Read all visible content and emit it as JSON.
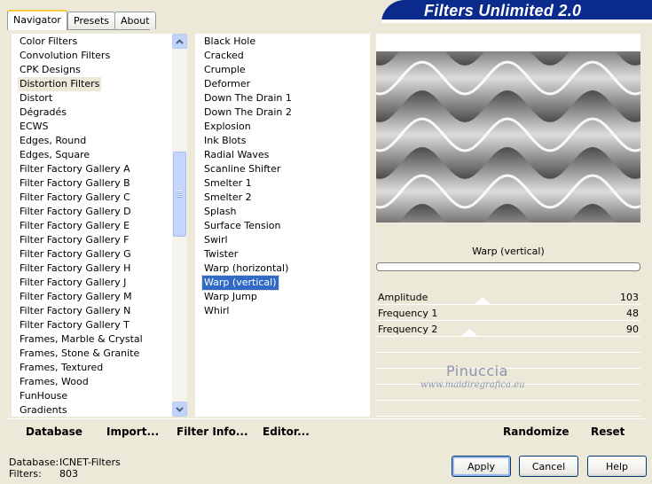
{
  "tabs": [
    {
      "label": "Navigator"
    },
    {
      "label": "Presets"
    },
    {
      "label": "About"
    }
  ],
  "banner_title": "Filters Unlimited 2.0",
  "categories": [
    "Color Filters",
    "Convolution Filters",
    "CPK Designs",
    "Distortion Filters",
    "Distort",
    "Dégradés",
    "ECWS",
    "Edges, Round",
    "Edges, Square",
    "Filter Factory Gallery A",
    "Filter Factory Gallery B",
    "Filter Factory Gallery C",
    "Filter Factory Gallery D",
    "Filter Factory Gallery E",
    "Filter Factory Gallery F",
    "Filter Factory Gallery G",
    "Filter Factory Gallery H",
    "Filter Factory Gallery J",
    "Filter Factory Gallery M",
    "Filter Factory Gallery N",
    "Filter Factory Gallery T",
    "Frames, Marble & Crystal",
    "Frames, Stone & Granite",
    "Frames, Textured",
    "Frames, Wood",
    "FunHouse",
    "Gradients"
  ],
  "selected_category_index": 3,
  "filters": [
    "Black Hole",
    "Cracked",
    "Crumple",
    "Deformer",
    "Down The Drain 1",
    "Down The Drain 2",
    "Explosion",
    "Ink Blots",
    "Radial Waves",
    "Scanline Shifter",
    "Smelter 1",
    "Smelter 2",
    "Splash",
    "Surface Tension",
    "Swirl",
    "Twister",
    "Warp (horizontal)",
    "Warp (vertical)",
    "Warp Jump",
    "Whirl"
  ],
  "selected_filter_index": 17,
  "filter_title": "Warp (vertical)",
  "params": [
    {
      "label": "Amplitude",
      "value": "103"
    },
    {
      "label": "Frequency 1",
      "value": "48"
    },
    {
      "label": "Frequency 2",
      "value": "90"
    }
  ],
  "watermark": {
    "name": "Pinuccia",
    "url": "www.maidiregrafica.eu"
  },
  "commands": {
    "database": "Database",
    "import": "Import...",
    "filter_info": "Filter Info...",
    "editor": "Editor...",
    "randomize": "Randomize",
    "reset": "Reset"
  },
  "status": {
    "database_label": "Database:",
    "database_value": "ICNET-Filters",
    "filters_label": "Filters:",
    "filters_value": "803"
  },
  "buttons": {
    "apply": "Apply",
    "cancel": "Cancel",
    "help": "Help"
  },
  "colors": {
    "selection": "#316AC5",
    "banner": "#0A2A8C",
    "face": "#ECE9D8"
  }
}
